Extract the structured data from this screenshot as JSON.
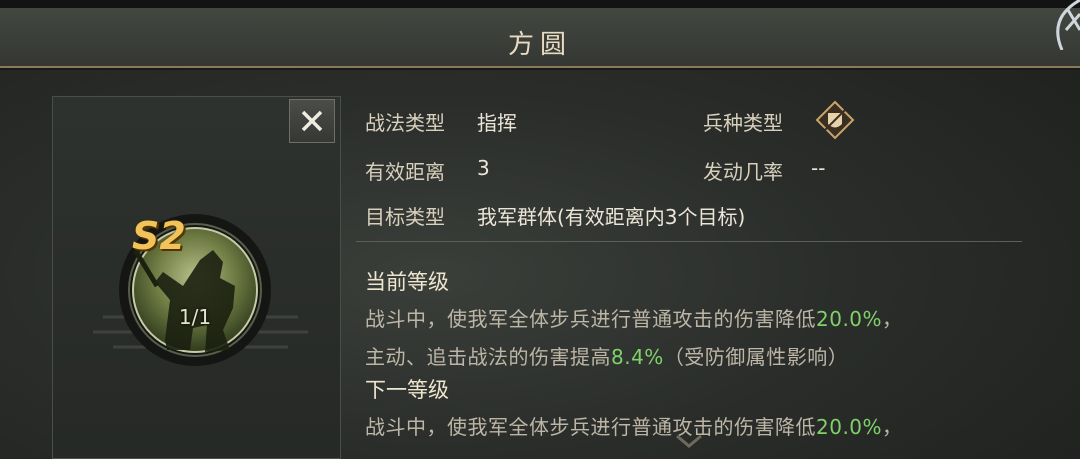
{
  "title": "方圆",
  "skill": {
    "grade": "S2",
    "level": "1/1"
  },
  "info": {
    "tactic_type_label": "战法类型",
    "tactic_type_value": "指挥",
    "troop_type_label": "兵种类型",
    "troop_type_icon": "shield-icon",
    "range_label": "有效距离",
    "range_value": "3",
    "chance_label": "发动几率",
    "chance_value": "--",
    "target_label": "目标类型",
    "target_value": "我军群体(有效距离内3个目标)"
  },
  "current": {
    "heading": "当前等级",
    "line1_a": "战斗中，使我军全体步兵进行普通攻击的伤害降低",
    "line1_pct": "20.0%",
    "line1_b": "，",
    "line2_a": "主动、追击战法的伤害提高",
    "line2_pct": "8.4%",
    "line2_b": "（受防御属性影响）"
  },
  "next": {
    "heading": "下一等级",
    "line1_a": "战斗中，使我军全体步兵进行普通攻击的伤害降低",
    "line1_pct": "20.0%",
    "line1_b": "，"
  },
  "colors": {
    "highlight": "#7fd16a",
    "grade": "#f1c35a"
  }
}
